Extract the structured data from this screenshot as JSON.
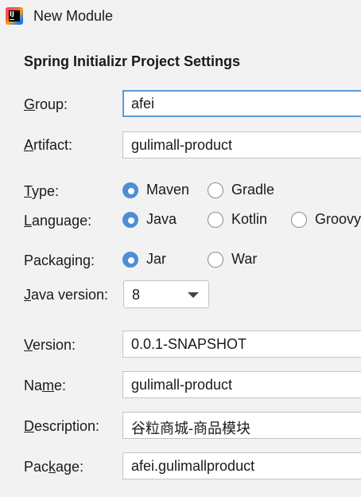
{
  "window": {
    "title": "New Module",
    "icon": "intellij-idea-icon"
  },
  "section_title": "Spring Initializr Project Settings",
  "fields": {
    "group": {
      "label_prefix": "",
      "mnemonic": "G",
      "label_suffix": "roup:",
      "value": "afei"
    },
    "artifact": {
      "label_prefix": "",
      "mnemonic": "A",
      "label_suffix": "rtifact:",
      "value": "gulimall-product"
    },
    "version": {
      "label_prefix": "",
      "mnemonic": "V",
      "label_suffix": "ersion:",
      "value": "0.0.1-SNAPSHOT"
    },
    "name": {
      "label_prefix": "Na",
      "mnemonic": "m",
      "label_suffix": "e:",
      "value": "gulimall-product"
    },
    "description": {
      "label_prefix": "",
      "mnemonic": "D",
      "label_suffix": "escription:",
      "value": "谷粒商城-商品模块"
    },
    "package": {
      "label_prefix": "Pac",
      "mnemonic": "k",
      "label_suffix": "age:",
      "value": "afei.gulimallproduct"
    }
  },
  "type": {
    "label_prefix": "",
    "mnemonic": "T",
    "label_suffix": "ype:",
    "options": [
      {
        "label": "Maven",
        "selected": true
      },
      {
        "label": "Gradle",
        "selected": false
      }
    ]
  },
  "language": {
    "label_prefix": "",
    "mnemonic": "L",
    "label_suffix": "anguage:",
    "options": [
      {
        "label": "Java",
        "selected": true
      },
      {
        "label": "Kotlin",
        "selected": false
      },
      {
        "label": "Groovy",
        "selected": false
      }
    ]
  },
  "packaging": {
    "label": "Packaging:",
    "options": [
      {
        "label": "Jar",
        "selected": true
      },
      {
        "label": "War",
        "selected": false
      }
    ]
  },
  "java_version": {
    "label_prefix": "",
    "mnemonic": "J",
    "label_suffix": "ava version:",
    "value": "8"
  },
  "colors": {
    "accent": "#4d8fd6",
    "focus_border": "#5b9ad9",
    "background": "#f2f2f2"
  }
}
